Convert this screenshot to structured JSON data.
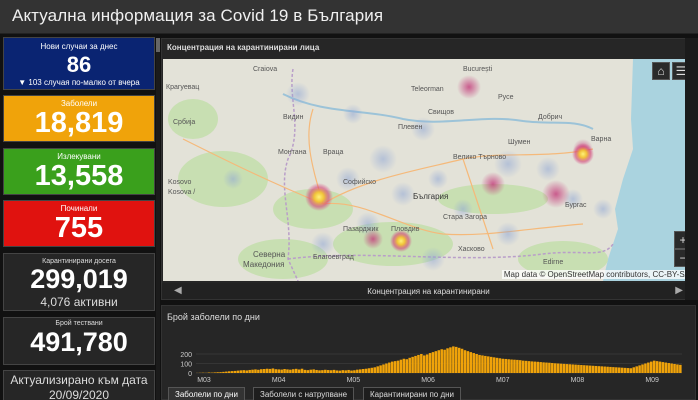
{
  "header": {
    "title": "Актуална информация за Covid 19 в България"
  },
  "stats": {
    "new_cases": {
      "title": "Нови случаи за днес",
      "value": "86",
      "sub": "▼ 103 случая по-малко от вчера"
    },
    "infected": {
      "title": "Заболели",
      "value": "18,819"
    },
    "recovered": {
      "title": "Излекувани",
      "value": "13,558"
    },
    "deceased": {
      "title": "Починали",
      "value": "755"
    },
    "quarantined": {
      "title": "Карантинирани досега",
      "value": "299,019",
      "sub": "4,076 активни"
    },
    "tested": {
      "title": "Брой тествани",
      "value": "491,780"
    },
    "updated": {
      "title": "Актуализирано към дата",
      "date": "20/09/2020"
    }
  },
  "map": {
    "title": "Концентрация на карантинирани лица",
    "nav_label": "Концентрация на карантинирани",
    "attribution": "Map data © OpenStreetMap contributors, CC-BY-SA",
    "zoom_in": "+",
    "zoom_out": "−",
    "places": {
      "bucharest": "București",
      "sofia": "Софийско",
      "bulgaria": "България",
      "kosovo": "Kosovo",
      "kosova": "Kosova /",
      "plovdiv": "Пловдив",
      "burgas": "Бургас",
      "varna": "Варна",
      "vidin": "Видин",
      "pleven": "Плевен",
      "ruse": "Русе",
      "veliko": "Велико Търново",
      "svishtov": "Свищов",
      "teleorman": "Teleorman",
      "craiova": "Craiova",
      "kragujevac": "Крагуевац",
      "stara": "Стара Загора",
      "haskovo": "Хасково",
      "pazardzhik": "Пазарджик",
      "blagoevgrad": "Благоевград",
      "sev_mak": "Северна",
      "makedonia": "Македония",
      "edirne": "Edirne",
      "dobrich": "Добрич",
      "shumen": "Шумен",
      "montana": "Монтана",
      "vratsa": "Враца",
      "serbia": "Србија"
    }
  },
  "chart_data": {
    "type": "bar",
    "title": "Брой заболели по дни",
    "yticks": [
      0,
      100,
      200
    ],
    "ylim": [
      0,
      400
    ],
    "x_labels": [
      "M03",
      "M04",
      "M05",
      "M06",
      "M07",
      "M08",
      "M09"
    ],
    "values": [
      1,
      2,
      3,
      2,
      5,
      4,
      6,
      8,
      9,
      12,
      15,
      18,
      20,
      22,
      25,
      28,
      30,
      27,
      32,
      35,
      38,
      34,
      40,
      42,
      45,
      43,
      48,
      40,
      38,
      36,
      42,
      38,
      35,
      40,
      44,
      37,
      45,
      33,
      30,
      35,
      38,
      32,
      28,
      30,
      34,
      31,
      29,
      33,
      27,
      25,
      30,
      28,
      32,
      26,
      29,
      35,
      38,
      42,
      45,
      50,
      55,
      60,
      70,
      80,
      90,
      100,
      110,
      120,
      125,
      130,
      140,
      150,
      145,
      160,
      170,
      180,
      190,
      200,
      185,
      195,
      210,
      220,
      230,
      240,
      250,
      245,
      260,
      270,
      280,
      275,
      265,
      255,
      240,
      230,
      220,
      210,
      200,
      190,
      185,
      180,
      175,
      170,
      165,
      160,
      155,
      150,
      148,
      145,
      142,
      140,
      138,
      135,
      130,
      128,
      125,
      122,
      120,
      118,
      115,
      112,
      110,
      108,
      105,
      102,
      100,
      98,
      96,
      94,
      92,
      90,
      88,
      86,
      84,
      82,
      80,
      78,
      76,
      74,
      72,
      70,
      68,
      66,
      64,
      62,
      60,
      58,
      56,
      54,
      52,
      50,
      60,
      70,
      80,
      90,
      100,
      110,
      120,
      130,
      125,
      120,
      115,
      110,
      105,
      100,
      95,
      90,
      86
    ],
    "color": "#f0a30a"
  },
  "chart_tabs": [
    "Заболели по дни",
    "Заболели с натрупване",
    "Карантинирани по дни"
  ],
  "colors": {
    "new_bg": "#0a2472",
    "infected_bg": "#f0a30a",
    "recovered_bg": "#3aa01c",
    "deceased_bg": "#e0120f"
  }
}
